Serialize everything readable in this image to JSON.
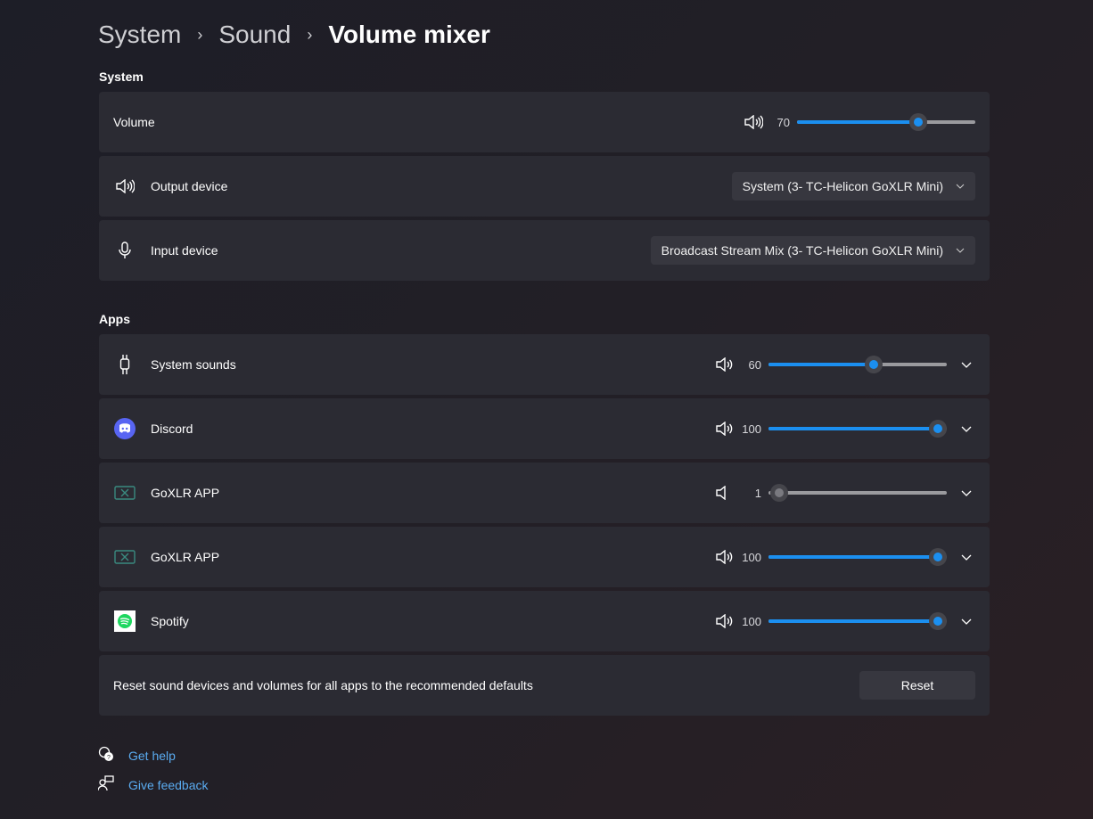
{
  "breadcrumb": [
    "System",
    "Sound",
    "Volume mixer"
  ],
  "system": {
    "heading": "System",
    "volume": {
      "label": "Volume",
      "value": 70
    },
    "output": {
      "label": "Output device",
      "selected": "System (3- TC-Helicon GoXLR Mini)"
    },
    "input": {
      "label": "Input device",
      "selected": "Broadcast Stream Mix (3- TC-Helicon GoXLR Mini)"
    }
  },
  "apps": {
    "heading": "Apps",
    "items": [
      {
        "name": "System sounds",
        "icon": "plug-icon",
        "value": 60
      },
      {
        "name": "Discord",
        "icon": "discord-icon",
        "value": 100
      },
      {
        "name": "GoXLR APP",
        "icon": "goxlr-icon",
        "value": 1
      },
      {
        "name": "GoXLR APP",
        "icon": "goxlr-icon",
        "value": 100
      },
      {
        "name": "Spotify",
        "icon": "spotify-icon",
        "value": 100
      }
    ]
  },
  "reset": {
    "text": "Reset sound devices and volumes for all apps to the recommended defaults",
    "button": "Reset"
  },
  "links": {
    "help": "Get help",
    "feedback": "Give feedback"
  },
  "colors": {
    "accent": "#1b8ff0",
    "card": "#2b2b33"
  }
}
